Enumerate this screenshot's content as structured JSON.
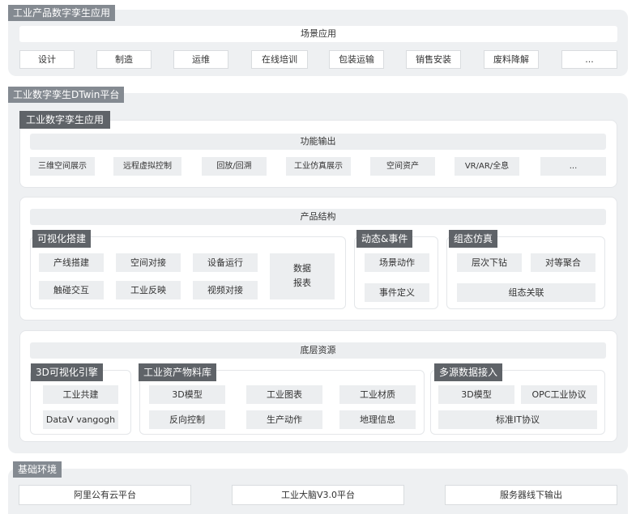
{
  "section1": {
    "title": "工业产品数字孪生应用",
    "header": "场景应用",
    "items": [
      "设计",
      "制造",
      "运维",
      "在线培训",
      "包装运输",
      "销售安装",
      "废料降解",
      "..."
    ]
  },
  "section2": {
    "title": "工业数字孪生DTwin平台",
    "app": {
      "title": "工业数字孪生应用",
      "header": "功能输出",
      "items": [
        "三维空间展示",
        "远程虚拟控制",
        "回放/回溯",
        "工业仿真展示",
        "空间资产",
        "VR/AR/全息",
        "..."
      ]
    },
    "product": {
      "header": "产品结构",
      "visual": {
        "title": "可视化搭建",
        "items": [
          "产线搭建",
          "空间对接",
          "设备运行",
          "触碰交互",
          "工业反映",
          "视频对接"
        ],
        "report": [
          "数据",
          "报表"
        ]
      },
      "event": {
        "title": "动态&事件",
        "items": [
          "场景动作",
          "事件定义"
        ]
      },
      "sim": {
        "title": "组态仿真",
        "items": [
          "层次下钻",
          "对等聚合",
          "组态关联"
        ]
      }
    },
    "base": {
      "header": "底层资源",
      "engine": {
        "title": "3D可视化引擎",
        "items": [
          "工业共建",
          "DataV vangogh"
        ]
      },
      "library": {
        "title": "工业资产物料库",
        "items": [
          "3D模型",
          "工业图表",
          "工业材质",
          "反向控制",
          "生产动作",
          "地理信息"
        ]
      },
      "multi": {
        "title": "多源数据接入",
        "items": [
          "3D模型",
          "OPC工业协议",
          "标准IT协议"
        ]
      }
    }
  },
  "section3": {
    "title": "基础环境",
    "items": [
      "阿里公有云平台",
      "工业大脑V3.0平台",
      "服务器线下输出"
    ]
  }
}
